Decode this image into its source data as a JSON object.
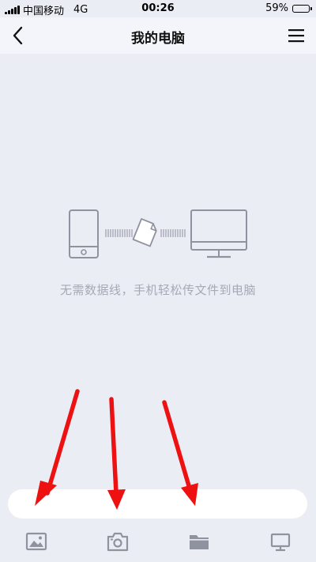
{
  "status_bar": {
    "carrier": "中国移动",
    "network": "4G",
    "time": "00:26",
    "battery_percent": "59%",
    "battery_level": 0.59
  },
  "header": {
    "title": "我的电脑",
    "back_icon": "chevron-left-icon",
    "menu_icon": "hamburger-menu-icon"
  },
  "empty_state": {
    "message": "无需数据线，手机轻松传文件到电脑",
    "icons": [
      "phone-icon",
      "file-transfer-icon",
      "monitor-icon"
    ]
  },
  "toolbar": {
    "items": [
      {
        "icon": "image-icon"
      },
      {
        "icon": "camera-icon"
      },
      {
        "icon": "folder-icon"
      },
      {
        "icon": "computer-icon"
      }
    ]
  },
  "colors": {
    "background": "#ebedf5",
    "nav_background": "#f4f5fa",
    "icon_gray": "#8f93a0",
    "text_gray": "#a6a9b4",
    "annotation_red": "#ee1111"
  }
}
